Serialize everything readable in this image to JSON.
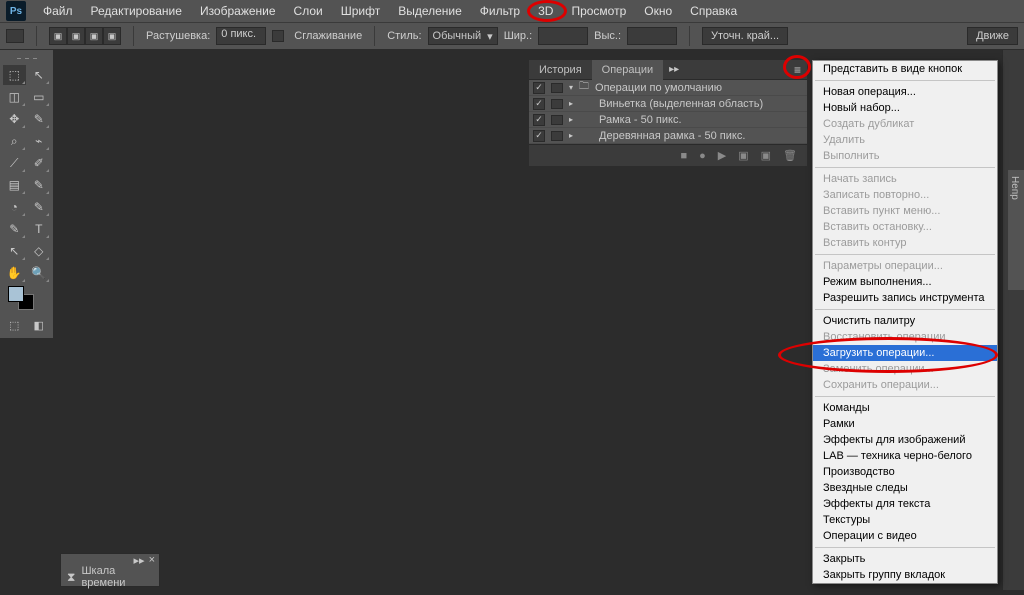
{
  "app": {
    "logo": "Ps"
  },
  "menu": [
    "Файл",
    "Редактирование",
    "Изображение",
    "Слои",
    "Шрифт",
    "Выделение",
    "Фильтр",
    "3D",
    "Просмотр",
    "Окно",
    "Справка"
  ],
  "options": {
    "feather_label": "Растушевка:",
    "feather_value": "0 пикс.",
    "antialias": "Сглаживание",
    "style_label": "Стиль:",
    "style_value": "Обычный",
    "width_label": "Шир.:",
    "height_label": "Выс.:",
    "refine": "Уточн. край...",
    "motion": "Движе"
  },
  "panel": {
    "tabs": [
      "История",
      "Операции"
    ],
    "set": "Операции по умолчанию",
    "rows": [
      "Виньетка (выделенная область)",
      "Рамка - 50 пикс.",
      "Деревянная рамка - 50 пикс."
    ],
    "foot_icons": [
      "■",
      "●",
      "▶",
      "▣",
      "▣",
      "🗑"
    ]
  },
  "flyout": {
    "groups": [
      [
        {
          "t": "Представить в виде кнопок",
          "d": false
        }
      ],
      [
        {
          "t": "Новая операция...",
          "d": false
        },
        {
          "t": "Новый набор...",
          "d": false
        },
        {
          "t": "Создать дубликат",
          "d": true
        },
        {
          "t": "Удалить",
          "d": true
        },
        {
          "t": "Выполнить",
          "d": true
        }
      ],
      [
        {
          "t": "Начать запись",
          "d": true
        },
        {
          "t": "Записать повторно...",
          "d": true
        },
        {
          "t": "Вставить пункт меню...",
          "d": true
        },
        {
          "t": "Вставить остановку...",
          "d": true
        },
        {
          "t": "Вставить контур",
          "d": true
        }
      ],
      [
        {
          "t": "Параметры операции...",
          "d": true
        },
        {
          "t": "Режим выполнения...",
          "d": false
        },
        {
          "t": "Разрешить запись инструмента",
          "d": false
        }
      ],
      [
        {
          "t": "Очистить палитру",
          "d": false
        },
        {
          "t": "Восстановить операции",
          "d": true
        },
        {
          "t": "Загрузить операции...",
          "d": false,
          "sel": true
        },
        {
          "t": "Заменить операции...",
          "d": true
        },
        {
          "t": "Сохранить операции...",
          "d": true
        }
      ],
      [
        {
          "t": "Команды",
          "d": false
        },
        {
          "t": "Рамки",
          "d": false
        },
        {
          "t": "Эффекты для изображений",
          "d": false
        },
        {
          "t": "LAB — техника черно-белого",
          "d": false
        },
        {
          "t": "Производство",
          "d": false
        },
        {
          "t": "Звездные следы",
          "d": false
        },
        {
          "t": "Эффекты для текста",
          "d": false
        },
        {
          "t": "Текстуры",
          "d": false
        },
        {
          "t": "Операции с видео",
          "d": false
        }
      ],
      [
        {
          "t": "Закрыть",
          "d": false
        },
        {
          "t": "Закрыть группу вкладок",
          "d": false
        }
      ]
    ]
  },
  "timeline": {
    "label": "Шкала времени"
  },
  "right": {
    "prop": "Непр"
  },
  "tool_icons": [
    [
      "⬚",
      "↖"
    ],
    [
      "◫",
      "▭"
    ],
    [
      "✥",
      "✎"
    ],
    [
      "⌕",
      "⌁"
    ],
    [
      "⟋",
      "✐"
    ],
    [
      "▤",
      "✎"
    ],
    [
      "◔",
      "✎"
    ],
    [
      "✎",
      "T"
    ],
    [
      "↖",
      "◇"
    ],
    [
      "✋",
      "🔍"
    ]
  ],
  "mini_icons": [
    "⬚",
    "◧"
  ]
}
